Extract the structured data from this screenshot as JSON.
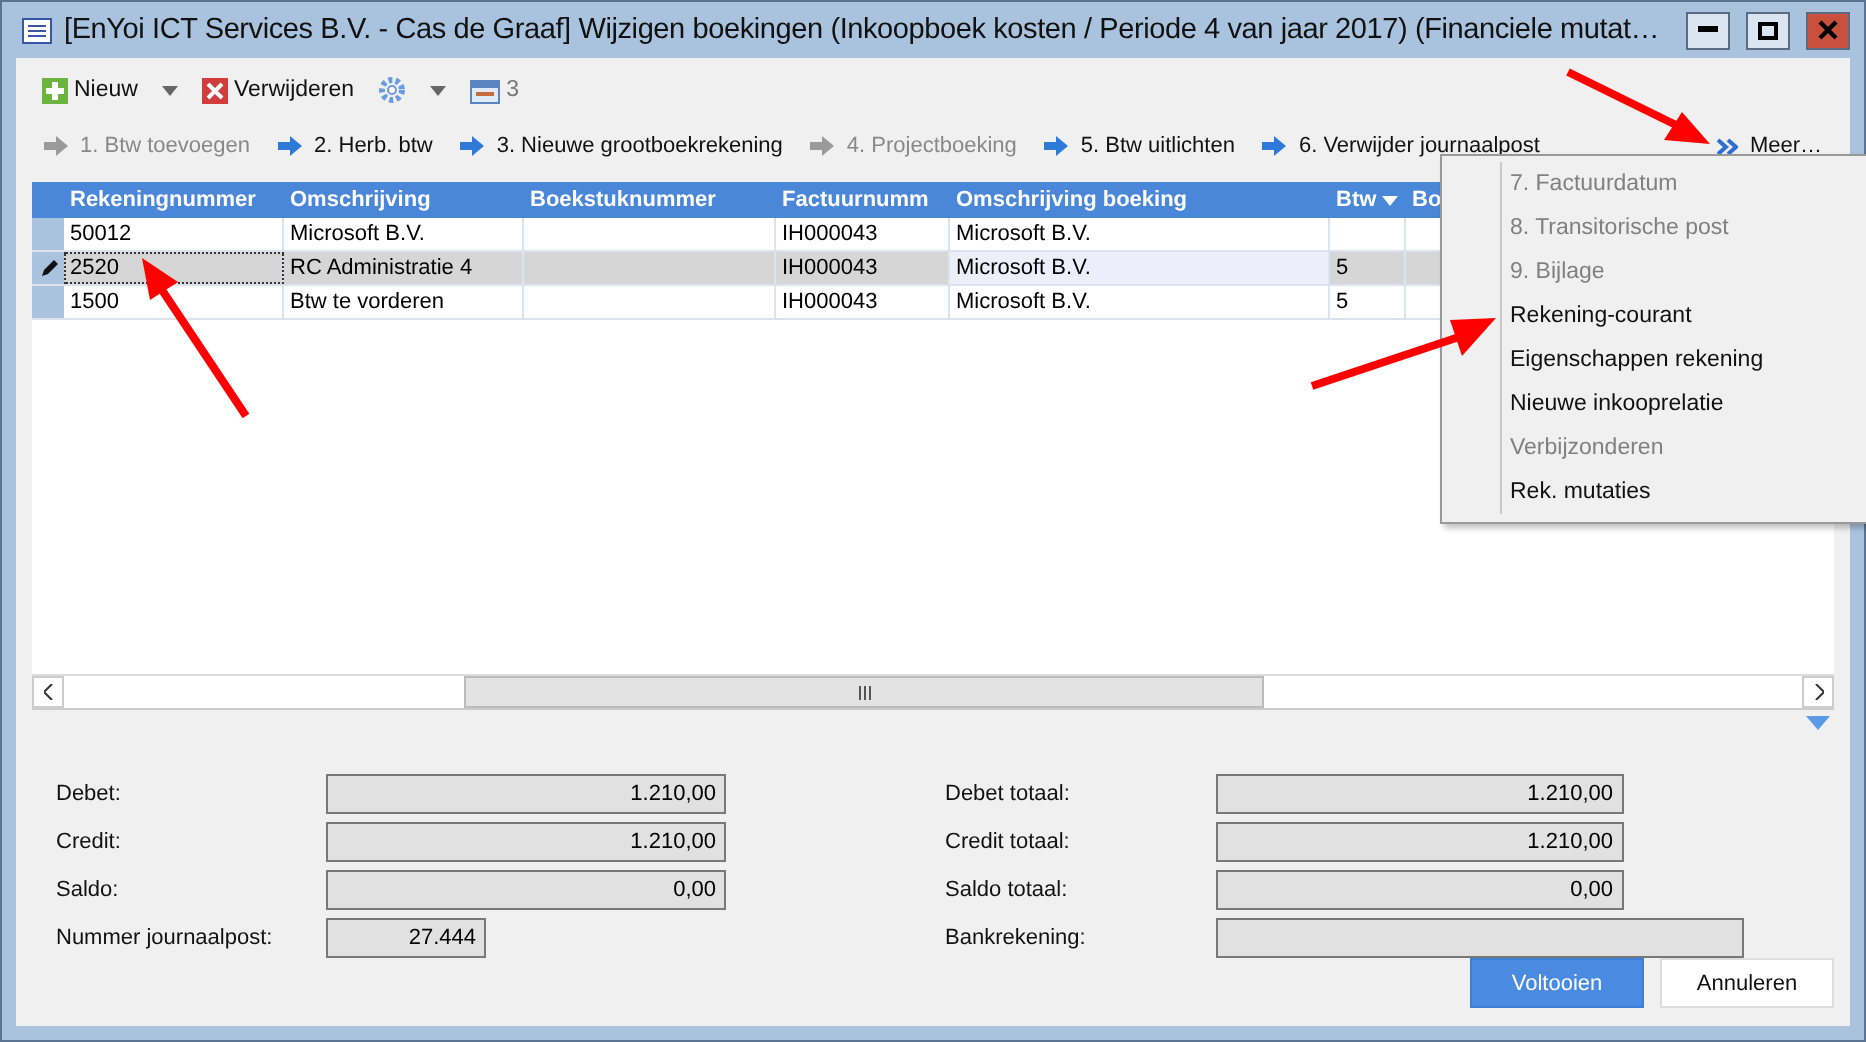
{
  "window": {
    "title": "[EnYoi ICT Services B.V. - Cas de Graaf]  Wijzigen boekingen (Inkoopboek kosten / Periode 4 van jaar 2017) (Financiele mutat…"
  },
  "toolbar": [
    {
      "kind": "new",
      "label": "Nieuw",
      "dropdown": true
    },
    {
      "kind": "delete",
      "label": "Verwijderen",
      "dropdown": false
    },
    {
      "kind": "settings",
      "dropdown": true
    },
    {
      "kind": "counter",
      "label": "3",
      "disabled": true
    }
  ],
  "actions": [
    {
      "label": "1. Btw toevoegen",
      "disabled": true
    },
    {
      "label": "2. Herb. btw",
      "disabled": false
    },
    {
      "label": "3. Nieuwe grootboekrekening",
      "disabled": false
    },
    {
      "label": "4. Projectboeking",
      "disabled": true
    },
    {
      "label": "5. Btw uitlichten",
      "disabled": false
    },
    {
      "label": "6. Verwijder journaalpost",
      "disabled": false
    }
  ],
  "more": {
    "label": "Meer…"
  },
  "grid": {
    "columns": [
      {
        "label": "Rekeningnummer"
      },
      {
        "label": "Omschrijving"
      },
      {
        "label": "Boekstuknummer"
      },
      {
        "label": "Factuurnumm"
      },
      {
        "label": "Omschrijving boeking"
      },
      {
        "label": "Btw",
        "filter": true
      },
      {
        "label": "Bo"
      }
    ],
    "rows": [
      {
        "selected": false,
        "cells": [
          "50012",
          "Microsoft B.V.",
          null,
          "IH000043",
          "Microsoft B.V.",
          null,
          null
        ]
      },
      {
        "selected": true,
        "cells": [
          "2520",
          "RC Administratie 4",
          null,
          "IH000043",
          "Microsoft B.V.",
          "5",
          null
        ]
      },
      {
        "selected": false,
        "cells": [
          "1500",
          "Btw te vorderen",
          null,
          "IH000043",
          "Microsoft B.V.",
          "5",
          null
        ]
      }
    ]
  },
  "menu": {
    "items": [
      {
        "label": "7. Factuurdatum",
        "disabled": true
      },
      {
        "label": "8. Transitorische post",
        "disabled": true
      },
      {
        "label": "9. Bijlage",
        "disabled": true
      },
      {
        "label": "Rekening-courant",
        "disabled": false
      },
      {
        "label": "Eigenschappen rekening",
        "disabled": false
      },
      {
        "label": "Nieuwe inkooprelatie",
        "disabled": false
      },
      {
        "label": "Verbijzonderen",
        "disabled": true
      },
      {
        "label": "Rek. mutaties",
        "disabled": false
      }
    ]
  },
  "totals": {
    "left": [
      {
        "label": "Debet:",
        "value": "1.210,00"
      },
      {
        "label": "Credit:",
        "value": "1.210,00"
      },
      {
        "label": "Saldo:",
        "value": "0,00"
      },
      {
        "label": "Nummer journaalpost:",
        "value": "27.444"
      }
    ],
    "right": [
      {
        "label": "Debet totaal:",
        "value": "1.210,00"
      },
      {
        "label": "Credit totaal:",
        "value": "1.210,00"
      },
      {
        "label": "Saldo totaal:",
        "value": "0,00"
      },
      {
        "label": "Bankrekening:"
      }
    ]
  },
  "buttons": [
    {
      "label": "Voltooien",
      "primary": true
    },
    {
      "label": "Annuleren",
      "primary": false
    }
  ]
}
